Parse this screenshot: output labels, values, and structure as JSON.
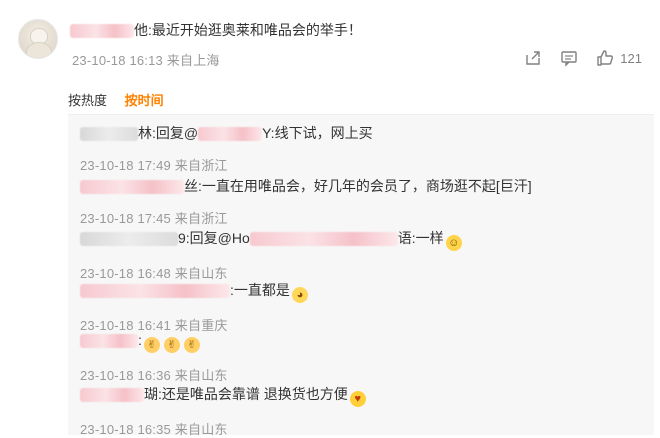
{
  "comment": {
    "name_tail": "他",
    "text": ":最近开始逛奥莱和唯品会的举手！",
    "meta": "23-10-18 16:13 来自上海",
    "like_count": "121"
  },
  "sort": {
    "hot": "按热度",
    "time": "按时间"
  },
  "replies": [
    {
      "name_tail": "林",
      "text": ":回复@",
      "text_b": "Y:线下试，网上买",
      "meta": "23-10-18 17:49 来自浙江"
    },
    {
      "name_tail": "丝",
      "text": ":一直在用唯品会，好几年的会员了，商场逛不起[巨汗]",
      "meta": "23-10-18 17:45 来自浙江"
    },
    {
      "name_tail": "9",
      "text": ":回复@Ho",
      "text_b": "语:一样",
      "meta": "23-10-18 16:48 来自山东"
    },
    {
      "name_tail": "",
      "text": ":一直都是",
      "meta": "23-10-18 16:41 来自重庆"
    },
    {
      "name_tail": "",
      "text": ":",
      "meta": "23-10-18 16:36 来自山东"
    },
    {
      "name_tail": "瑚",
      "text": ":还是唯品会靠谱  退换货也方便",
      "meta": "23-10-18 16:35 来自山东"
    }
  ],
  "colors": {
    "accent": "#ff8200",
    "meta": "#999999",
    "reply_bg": "#f7f7f7"
  }
}
